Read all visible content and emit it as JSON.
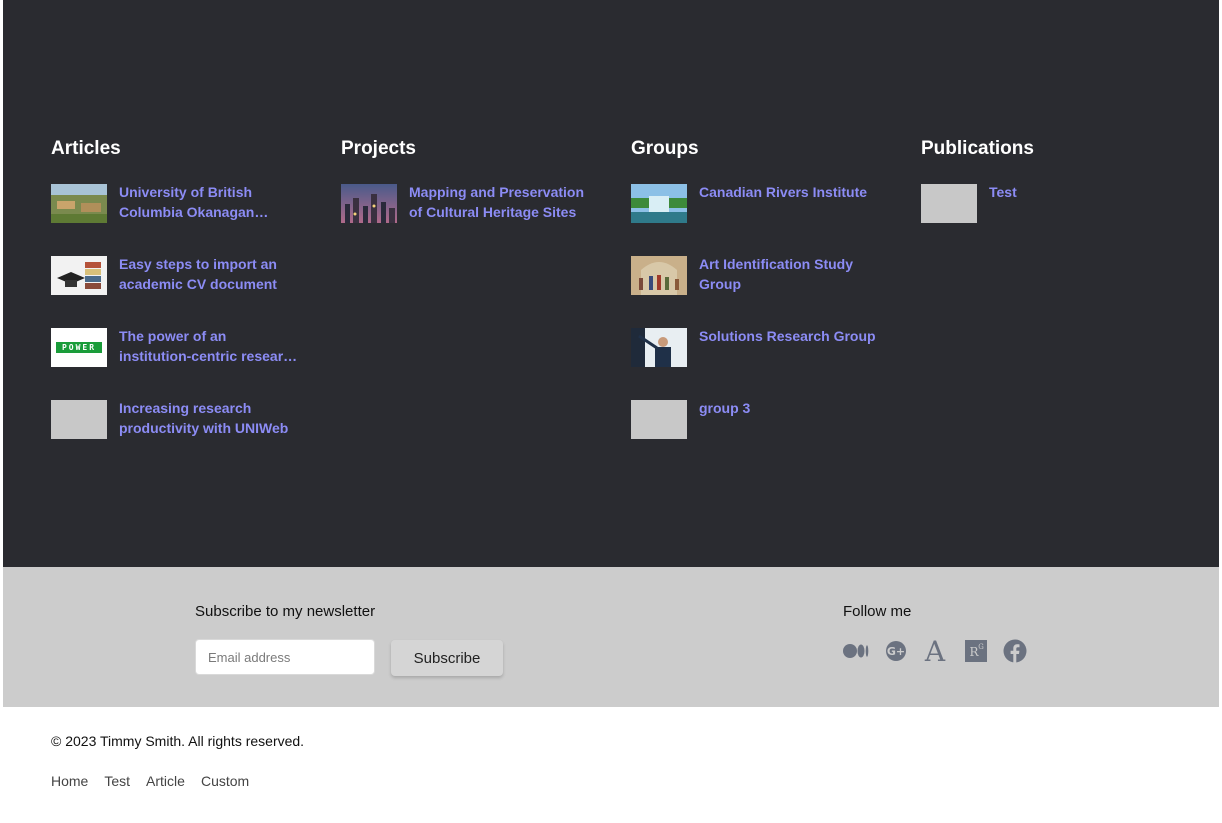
{
  "sections": {
    "articles": {
      "title": "Articles",
      "items": [
        {
          "title": "University of British Columbia Okanagan…"
        },
        {
          "title": "Easy steps to import an academic CV document"
        },
        {
          "title": "The power of an institution-centric resear…",
          "thumb_text": "POWER"
        },
        {
          "title": "Increasing research productivity with UNIWeb"
        }
      ]
    },
    "projects": {
      "title": "Projects",
      "items": [
        {
          "title": "Mapping and Preservation of Cultural Heritage Sites"
        }
      ]
    },
    "groups": {
      "title": "Groups",
      "items": [
        {
          "title": "Canadian Rivers Institute"
        },
        {
          "title": "Art Identification Study Group"
        },
        {
          "title": "Solutions Research Group"
        },
        {
          "title": "group 3"
        }
      ]
    },
    "publications": {
      "title": "Publications",
      "items": [
        {
          "title": "Test"
        }
      ]
    }
  },
  "newsletter": {
    "title": "Subscribe to my newsletter",
    "email_placeholder": "Email address",
    "subscribe_label": "Subscribe"
  },
  "follow": {
    "title": "Follow me",
    "icons": [
      "medium-icon",
      "google-plus-icon",
      "academia-icon",
      "researchgate-icon",
      "facebook-icon"
    ],
    "icon_color": "#6b7280"
  },
  "footer": {
    "copyright": "© 2023 Timmy Smith. All rights reserved.",
    "nav": [
      "Home",
      "Test",
      "Article",
      "Custom"
    ]
  },
  "colors": {
    "dark_bg": "#2a2b30",
    "link": "#8c8cf5",
    "newsletter_bg": "#cccccc"
  }
}
